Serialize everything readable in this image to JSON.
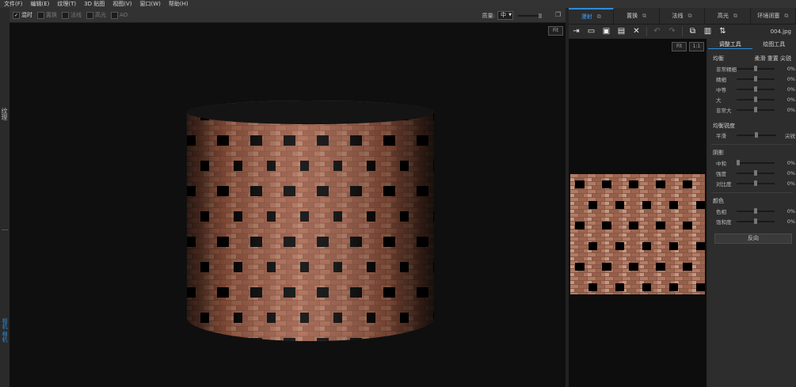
{
  "menu": [
    "文件(F)",
    "编辑(E)",
    "纹理(T)",
    "3D 贴图",
    "视图(V)",
    "窗口(W)",
    "帮助(H)"
  ],
  "left_tabs": {
    "top": "纹理",
    "bottom": "相机 相机"
  },
  "viewport_toolbar": {
    "toggles": [
      {
        "label": "混时",
        "checked": true
      },
      {
        "label": "置换",
        "checked": false
      },
      {
        "label": "法线",
        "checked": false
      },
      {
        "label": "高光",
        "checked": false
      },
      {
        "label": "AO",
        "checked": false
      }
    ],
    "quality_label": "质量:",
    "quality_value": "中"
  },
  "fit_label": "Fit",
  "one_label": "1:1",
  "right_tabs": [
    {
      "label": "漫射",
      "active": true
    },
    {
      "label": "置换",
      "active": false
    },
    {
      "label": "法线",
      "active": false
    },
    {
      "label": "高光",
      "active": false
    },
    {
      "label": "环境闭塞",
      "active": false
    }
  ],
  "file_name": "004.jpg",
  "adjust": {
    "tabs": [
      "调整工具",
      "绘图工具"
    ],
    "sections": {
      "equalize": {
        "title": "均衡",
        "options": "柔滑 重置 尖锐"
      },
      "equalize_rows": [
        {
          "name": "非常精细",
          "value": "0%"
        },
        {
          "name": "精细",
          "value": "0%"
        },
        {
          "name": "中等",
          "value": "0%"
        },
        {
          "name": "大",
          "value": "0%"
        },
        {
          "name": "非常大",
          "value": "0%"
        }
      ],
      "sharpen": {
        "title": "均衡锐度",
        "left": "平滑",
        "right": "尖锐"
      },
      "shadow": {
        "title": "阴影"
      },
      "shadow_rows": [
        {
          "name": "中和",
          "value": "0%"
        },
        {
          "name": "强度",
          "value": "0%"
        },
        {
          "name": "对比度",
          "value": "0%"
        }
      ],
      "color": {
        "title": "颜色"
      },
      "color_rows": [
        {
          "name": "色相",
          "value": "0%"
        },
        {
          "name": "饱和度",
          "value": "0%"
        }
      ],
      "invert_label": "反向"
    }
  }
}
